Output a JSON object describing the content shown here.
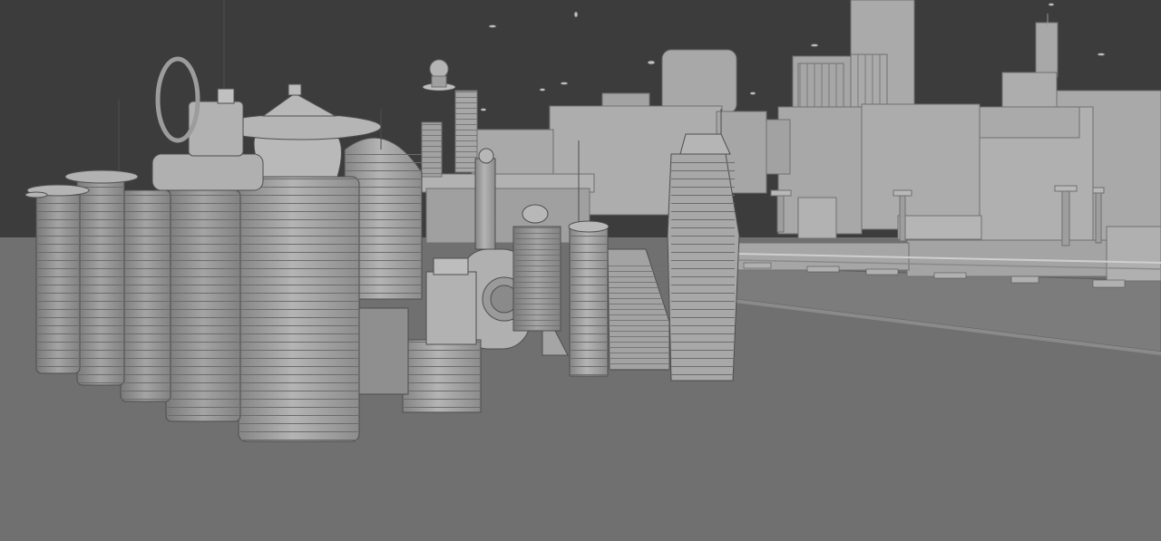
{
  "scene": {
    "colors": {
      "sky": "#3c3c3c",
      "ground": "#707070",
      "building_light": "#a9a9a9",
      "building_mid": "#9a9a9a",
      "building_shadow": "#7e7e7e",
      "outline": "#4a4a4a"
    },
    "elements": {
      "sky": "sky",
      "ground": "ground-plane",
      "skyline": "background-skyline",
      "towers": "foreground-towers",
      "aircraft": "flying-vehicles"
    }
  }
}
